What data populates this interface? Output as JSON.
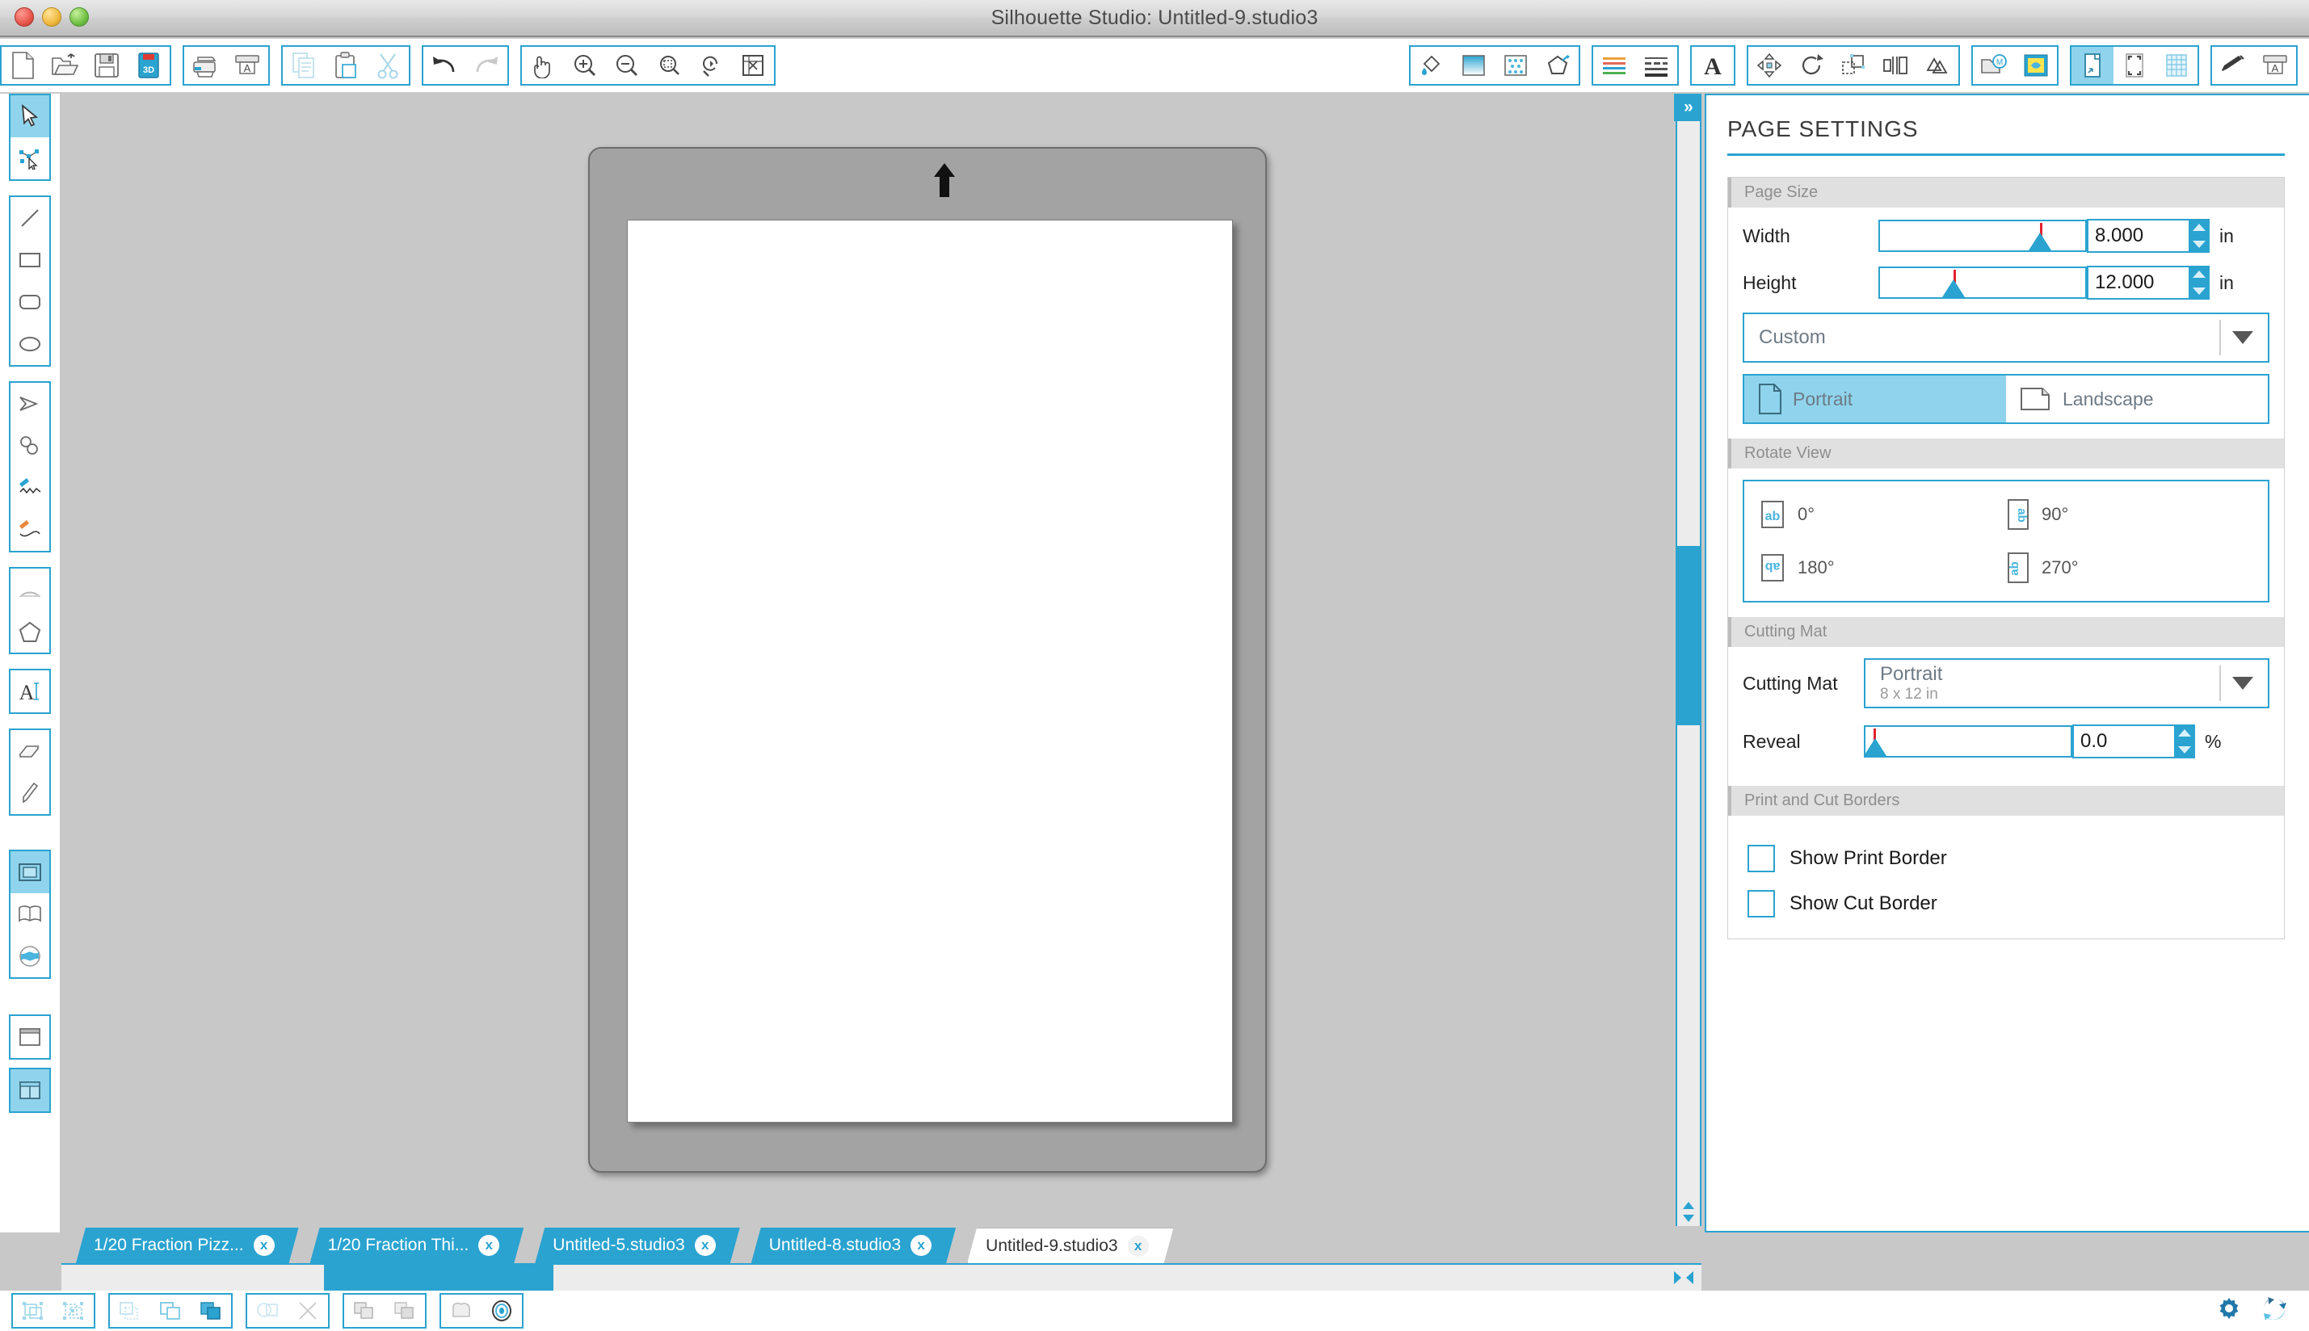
{
  "window": {
    "title": "Silhouette Studio: Untitled-9.studio3",
    "controls": {
      "close": "close",
      "minimize": "minimize",
      "zoom": "zoom"
    }
  },
  "toolbar": {
    "groups": [
      {
        "name": "file",
        "buttons": [
          {
            "icon": "new-document-icon",
            "label": "New"
          },
          {
            "icon": "open-folder-icon",
            "label": "Open"
          },
          {
            "icon": "save-icon",
            "label": "Save"
          },
          {
            "icon": "save-3d-icon",
            "label": "Save 3D"
          }
        ]
      },
      {
        "name": "print",
        "buttons": [
          {
            "icon": "print-icon",
            "label": "Print"
          },
          {
            "icon": "send-to-silhouette-icon",
            "label": "Send"
          }
        ]
      },
      {
        "name": "clipboard",
        "buttons": [
          {
            "icon": "copy-icon",
            "label": "Copy"
          },
          {
            "icon": "paste-icon",
            "label": "Paste"
          },
          {
            "icon": "cut-scissors-icon",
            "label": "Cut"
          }
        ]
      },
      {
        "name": "history",
        "buttons": [
          {
            "icon": "undo-icon",
            "label": "Undo"
          },
          {
            "icon": "redo-icon",
            "label": "Redo"
          }
        ]
      },
      {
        "name": "view",
        "buttons": [
          {
            "icon": "pan-hand-icon",
            "label": "Pan"
          },
          {
            "icon": "zoom-in-icon",
            "label": "Zoom In"
          },
          {
            "icon": "zoom-out-icon",
            "label": "Zoom Out"
          },
          {
            "icon": "zoom-selection-icon",
            "label": "Zoom to Selection"
          },
          {
            "icon": "zoom-reset-icon",
            "label": "Reset View"
          },
          {
            "icon": "fit-to-window-icon",
            "label": "Fit to Window"
          }
        ]
      },
      {
        "name": "fill-style",
        "buttons": [
          {
            "icon": "fill-color-icon",
            "label": "Fill Color"
          },
          {
            "icon": "gradient-fill-icon",
            "label": "Gradient Fill"
          },
          {
            "icon": "pattern-fill-icon",
            "label": "Pattern Fill"
          },
          {
            "icon": "line-color-icon",
            "label": "Line Color"
          }
        ]
      },
      {
        "name": "line-style",
        "buttons": [
          {
            "icon": "line-color-swatches-icon",
            "label": "Line Color"
          },
          {
            "icon": "line-style-icon",
            "label": "Line Style"
          }
        ]
      },
      {
        "name": "text",
        "buttons": [
          {
            "icon": "text-style-icon",
            "label": "Text Style"
          }
        ]
      },
      {
        "name": "transform",
        "buttons": [
          {
            "icon": "move-icon",
            "label": "Move"
          },
          {
            "icon": "rotate-icon",
            "label": "Rotate"
          },
          {
            "icon": "scale-icon",
            "label": "Scale"
          },
          {
            "icon": "align-icon",
            "label": "Align"
          },
          {
            "icon": "replicate-icon",
            "label": "Replicate"
          }
        ]
      },
      {
        "name": "library",
        "buttons": [
          {
            "icon": "my-library-icon",
            "label": "My Library"
          },
          {
            "icon": "store-icon",
            "label": "Store"
          }
        ]
      },
      {
        "name": "page",
        "buttons": [
          {
            "icon": "page-settings-icon",
            "label": "Page Settings",
            "active": true
          },
          {
            "icon": "registration-marks-icon",
            "label": "Registration Marks"
          },
          {
            "icon": "grid-icon",
            "label": "Grid"
          }
        ]
      },
      {
        "name": "cut",
        "buttons": [
          {
            "icon": "cut-settings-icon",
            "label": "Cut Settings"
          },
          {
            "icon": "send-to-cut-icon",
            "label": "Send to Silhouette"
          }
        ]
      }
    ]
  },
  "left_tools": {
    "groups": [
      {
        "name": "selection",
        "tools": [
          {
            "icon": "select-arrow-icon",
            "label": "Select",
            "active": true
          },
          {
            "icon": "edit-points-icon",
            "label": "Edit Points"
          }
        ]
      },
      {
        "name": "shapes",
        "tools": [
          {
            "icon": "line-tool-icon",
            "label": "Line"
          },
          {
            "icon": "rectangle-tool-icon",
            "label": "Rectangle"
          },
          {
            "icon": "rounded-rectangle-tool-icon",
            "label": "Rounded Rectangle"
          },
          {
            "icon": "ellipse-tool-icon",
            "label": "Ellipse"
          }
        ]
      },
      {
        "name": "draw",
        "tools": [
          {
            "icon": "polygon-tool-icon",
            "label": "Polygon"
          },
          {
            "icon": "curve-tool-icon",
            "label": "Curve"
          },
          {
            "icon": "draw-freehand-icon",
            "label": "Draw Freehand"
          },
          {
            "icon": "draw-smooth-icon",
            "label": "Draw Smooth Freehand"
          }
        ]
      },
      {
        "name": "arc-poly",
        "tools": [
          {
            "icon": "arc-tool-icon",
            "label": "Arc"
          },
          {
            "icon": "regular-polygon-tool-icon",
            "label": "Regular Polygon"
          }
        ]
      },
      {
        "name": "text",
        "tools": [
          {
            "icon": "text-tool-icon",
            "label": "Text"
          }
        ]
      },
      {
        "name": "eraser",
        "tools": [
          {
            "icon": "eraser-tool-icon",
            "label": "Eraser"
          },
          {
            "icon": "knife-tool-icon",
            "label": "Knife"
          }
        ]
      },
      {
        "name": "panels",
        "tools": [
          {
            "icon": "design-page-icon",
            "label": "Design Page",
            "active": true
          },
          {
            "icon": "library-book-icon",
            "label": "Library"
          },
          {
            "icon": "store-globe-icon",
            "label": "Store"
          }
        ]
      },
      {
        "name": "layout",
        "tools": [
          {
            "icon": "single-pane-icon",
            "label": "Single Pane"
          },
          {
            "icon": "split-pane-icon",
            "label": "Split Pane",
            "active": true
          }
        ]
      }
    ]
  },
  "canvas": {
    "mat_arrow_label": "mat-feed-direction",
    "page_label": "design-page"
  },
  "panel": {
    "title": "PAGE SETTINGS",
    "expander": "»",
    "page_size": {
      "heading": "Page Size",
      "width_label": "Width",
      "width_value": "8.000",
      "width_unit": "in",
      "height_label": "Height",
      "height_value": "12.000",
      "height_unit": "in",
      "preset": "Custom",
      "orientation": {
        "portrait": "Portrait",
        "landscape": "Landscape",
        "selected": "Portrait"
      }
    },
    "rotate_view": {
      "heading": "Rotate View",
      "options": [
        {
          "label": "0°",
          "glyph": "ab",
          "rotation": 0
        },
        {
          "label": "90°",
          "glyph": "ab",
          "rotation": 90
        },
        {
          "label": "180°",
          "glyph": "ab",
          "rotation": 180
        },
        {
          "label": "270°",
          "glyph": "ab",
          "rotation": 270
        }
      ]
    },
    "cutting_mat": {
      "heading": "Cutting Mat",
      "label": "Cutting Mat",
      "value": "Portrait",
      "sub": "8 x 12 in",
      "reveal_label": "Reveal",
      "reveal_value": "0.0",
      "reveal_unit": "%"
    },
    "print_cut": {
      "heading": "Print and Cut Borders",
      "show_print_border": "Show Print Border",
      "show_cut_border": "Show Cut Border",
      "print_border_checked": false,
      "cut_border_checked": false
    }
  },
  "tabs": [
    {
      "label": "1/20 Fraction Pizz...",
      "close": "x",
      "active": false
    },
    {
      "label": "1/20 Fraction Thi...",
      "close": "x",
      "active": false
    },
    {
      "label": "Untitled-5.studio3",
      "close": "x",
      "active": false
    },
    {
      "label": "Untitled-8.studio3",
      "close": "x",
      "active": false
    },
    {
      "label": "Untitled-9.studio3",
      "close": "x",
      "active": true
    }
  ],
  "bottom_bar": {
    "groups": [
      {
        "name": "group-ungroup",
        "buttons": [
          {
            "icon": "group-icon",
            "label": "Group"
          },
          {
            "icon": "ungroup-icon",
            "label": "Ungroup"
          }
        ]
      },
      {
        "name": "arrange",
        "buttons": [
          {
            "icon": "make-compound-path-icon",
            "label": "Make Compound Path"
          },
          {
            "icon": "send-to-back-icon",
            "label": "Send to Back"
          },
          {
            "icon": "bring-to-front-icon",
            "label": "Bring to Front"
          }
        ]
      },
      {
        "name": "weld",
        "buttons": [
          {
            "icon": "weld-icon",
            "label": "Weld"
          },
          {
            "icon": "detach-icon",
            "label": "Detach"
          }
        ]
      },
      {
        "name": "modify",
        "buttons": [
          {
            "icon": "subtract-icon",
            "label": "Subtract"
          },
          {
            "icon": "intersect-icon",
            "label": "Intersect"
          }
        ]
      },
      {
        "name": "offset-trace",
        "buttons": [
          {
            "icon": "offset-icon",
            "label": "Offset"
          },
          {
            "icon": "trace-icon",
            "label": "Trace"
          }
        ]
      }
    ],
    "right": [
      {
        "icon": "gear-icon",
        "label": "Preferences"
      },
      {
        "icon": "sync-icon",
        "label": "Sync"
      }
    ]
  },
  "colors": {
    "accent": "#2aa3d0",
    "accent_light": "#8fd4ec",
    "canvas_bg": "#c8c8c8",
    "mat_gray": "#a3a3a3",
    "slider_tick": "#e2212e"
  }
}
